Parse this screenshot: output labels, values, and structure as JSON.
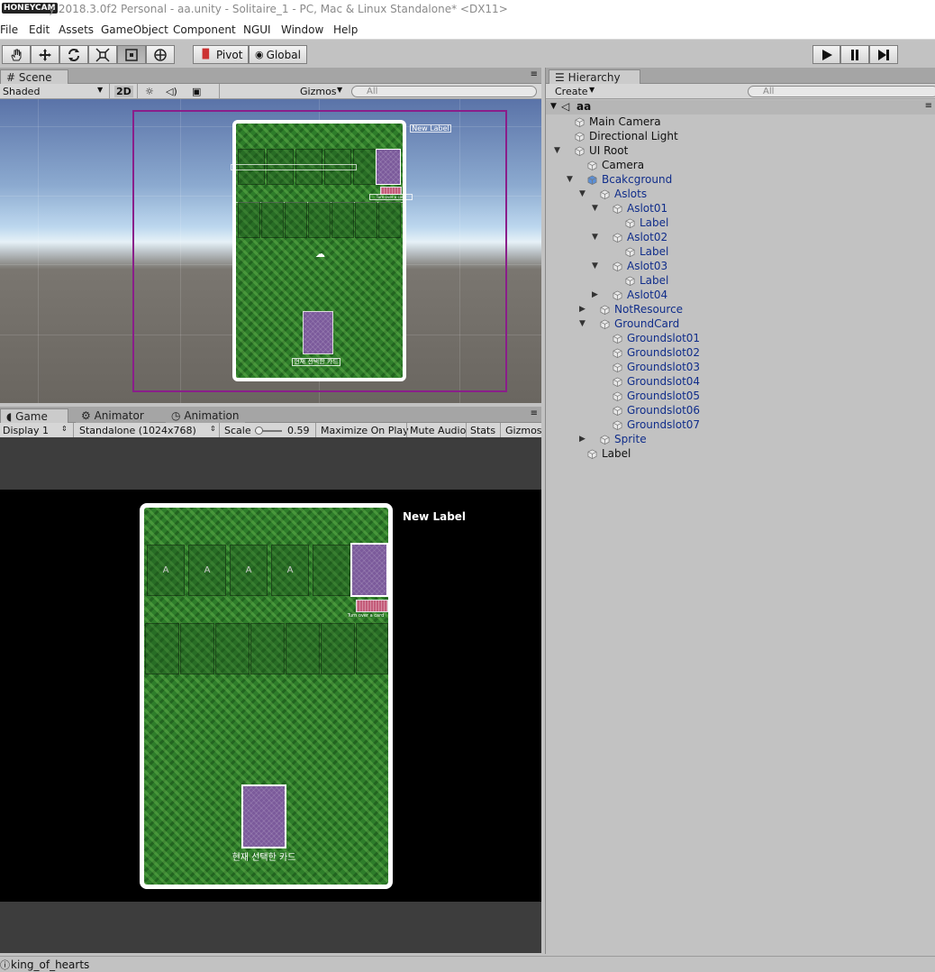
{
  "title_bar": {
    "logo": "HONEYCAM",
    "title": "y 2018.3.0f2 Personal - aa.unity - Solitaire_1 - PC, Mac & Linux Standalone* <DX11>"
  },
  "menu": [
    "File",
    "Edit",
    "Assets",
    "GameObject",
    "Component",
    "NGUI",
    "Window",
    "Help"
  ],
  "toolbar": {
    "pivot_label": "Pivot",
    "global_label": "Global"
  },
  "scene_panel": {
    "tab_label": "Scene",
    "shading_mode": "Shaded",
    "mode_2d": "2D",
    "gizmos_label": "Gizmos",
    "search_placeholder": "All",
    "new_label": "New Label",
    "turn_card_label": "Turn over a card",
    "selected_card_label": "현재 선택한 카드"
  },
  "game_panel": {
    "tabs": [
      "Game",
      "Animator",
      "Animation"
    ],
    "display": "Display 1",
    "resolution": "Standalone (1024x768)",
    "scale_label": "Scale",
    "scale_value": "0.59",
    "maximize_label": "Maximize On Play",
    "mute_label": "Mute Audio",
    "stats_label": "Stats",
    "gizmos_label": "Gizmos",
    "new_label": "New Label",
    "slot_letter": "A",
    "turn_card_label": "Turn over a card",
    "selected_card_label": "현재 선택한 카드"
  },
  "hierarchy": {
    "tab_label": "Hierarchy",
    "create_label": "Create",
    "search_placeholder": "All",
    "scene_name": "aa",
    "items": [
      {
        "label": "Main Camera",
        "depth": 1,
        "arrow": ""
      },
      {
        "label": "Directional Light",
        "depth": 1,
        "arrow": ""
      },
      {
        "label": "UI Root",
        "depth": 1,
        "arrow": "down"
      },
      {
        "label": "Camera",
        "depth": 2,
        "arrow": ""
      },
      {
        "label": "Bcakcground",
        "depth": 2,
        "arrow": "down"
      },
      {
        "label": "Aslots",
        "depth": 3,
        "arrow": "down"
      },
      {
        "label": "Aslot01",
        "depth": 4,
        "arrow": "down"
      },
      {
        "label": "Label",
        "depth": 5,
        "arrow": ""
      },
      {
        "label": "Aslot02",
        "depth": 4,
        "arrow": "down"
      },
      {
        "label": "Label",
        "depth": 5,
        "arrow": ""
      },
      {
        "label": "Aslot03",
        "depth": 4,
        "arrow": "down"
      },
      {
        "label": "Label",
        "depth": 5,
        "arrow": ""
      },
      {
        "label": "Aslot04",
        "depth": 4,
        "arrow": "right"
      },
      {
        "label": "NotResource",
        "depth": 3,
        "arrow": "right"
      },
      {
        "label": "GroundCard",
        "depth": 3,
        "arrow": "down"
      },
      {
        "label": "Groundslot01",
        "depth": 4,
        "arrow": ""
      },
      {
        "label": "Groundslot02",
        "depth": 4,
        "arrow": ""
      },
      {
        "label": "Groundslot03",
        "depth": 4,
        "arrow": ""
      },
      {
        "label": "Groundslot04",
        "depth": 4,
        "arrow": ""
      },
      {
        "label": "Groundslot05",
        "depth": 4,
        "arrow": ""
      },
      {
        "label": "Groundslot06",
        "depth": 4,
        "arrow": ""
      },
      {
        "label": "Groundslot07",
        "depth": 4,
        "arrow": ""
      },
      {
        "label": "Sprite",
        "depth": 3,
        "arrow": "right"
      },
      {
        "label": "Label",
        "depth": 2,
        "arrow": ""
      }
    ]
  },
  "status_bar": {
    "message": "king_of_hearts"
  },
  "colors": {
    "selection_purple": "#8a1e8a",
    "felt_green": "#2e7d2a",
    "card_purple": "#7b5a9b",
    "card_pink": "#c45c7a",
    "hierarchy_blue": "#102d8a"
  },
  "icons": [
    "hand-tool-icon",
    "move-tool-icon",
    "rotate-tool-icon",
    "scale-tool-icon",
    "rect-tool-icon",
    "transform-tool-icon",
    "play-icon",
    "pause-icon",
    "step-icon",
    "sun-icon",
    "audio-icon",
    "image-icon",
    "unity-scene-icon",
    "gameobject-cube-icon",
    "warning-icon"
  ]
}
